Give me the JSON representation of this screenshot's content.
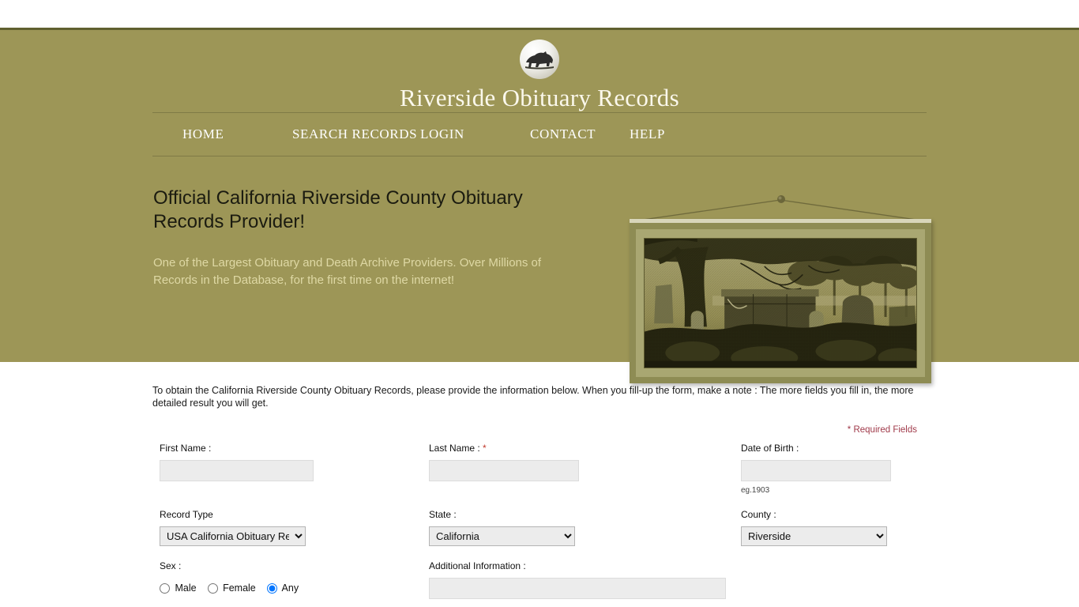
{
  "site": {
    "title": "Riverside Obituary Records",
    "logo_icon": "california-bear-icon",
    "band_color": "#9d9657"
  },
  "nav": {
    "items": [
      {
        "label": "HOME"
      },
      {
        "label": "SEARCH RECORDS"
      },
      {
        "label": "LOGIN"
      },
      {
        "label": "CONTACT"
      },
      {
        "label": "HELP"
      }
    ]
  },
  "hero": {
    "heading": "Official California Riverside County Obituary Records Provider!",
    "subheading": "One of the Largest Obituary and Death Archive Providers. Over Millions of Records in the Database, for the first time on the internet!",
    "image_alt": "cemetery-engraving"
  },
  "form": {
    "intro": "To obtain the California Riverside County Obituary Records, please provide the information below. When you fill-up the form, make a note : The more fields you fill in, the more detailed result you will get.",
    "required_note": "* Required Fields",
    "first_name": {
      "label": "First Name :",
      "value": "",
      "placeholder": ""
    },
    "last_name": {
      "label": "Last Name :",
      "required_mark": "*",
      "value": "",
      "placeholder": ""
    },
    "date_of_birth": {
      "label": "Date of Birth :",
      "value": "",
      "placeholder": "",
      "hint": "eg.1903"
    },
    "record_type": {
      "label": "Record Type",
      "selected": "USA California Obituary Records",
      "options": [
        "USA California Obituary Records"
      ]
    },
    "state": {
      "label": "State :",
      "selected": "California",
      "options": [
        "California"
      ]
    },
    "county": {
      "label": "County :",
      "selected": "Riverside",
      "options": [
        "Riverside"
      ]
    },
    "sex": {
      "label": "Sex :",
      "options": [
        {
          "label": "Male",
          "checked": false
        },
        {
          "label": "Female",
          "checked": false
        },
        {
          "label": "Any",
          "checked": true
        }
      ]
    },
    "additional_information": {
      "label": "Additional Information :",
      "value": "",
      "placeholder": ""
    }
  }
}
